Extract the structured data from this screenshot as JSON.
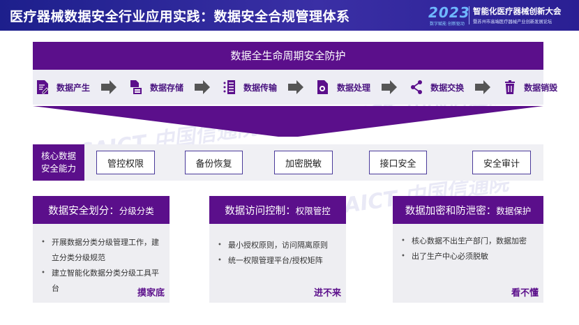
{
  "header": {
    "title": "医疗器械数据安全行业应用实践：数据安全合规管理体系",
    "conference": {
      "year": "2023",
      "slogan": "数字赋能 创新驱动",
      "name": "智能化医疗器械创新大会",
      "subtitle": "暨苏州市高端医疗器械产业创新发展论坛"
    }
  },
  "watermark": {
    "text": "CAICT 中国信通院"
  },
  "lifecycle": {
    "title": "数据全生命周期安全防护",
    "stages": [
      {
        "label": "数据产生",
        "icon": "document-edit-icon"
      },
      {
        "label": "数据存储",
        "icon": "document-storage-icon"
      },
      {
        "label": "数据传输",
        "icon": "transfer-list-icon"
      },
      {
        "label": "数据处理",
        "icon": "document-process-icon"
      },
      {
        "label": "数据交换",
        "icon": "share-icon"
      },
      {
        "label": "数据销毁",
        "icon": "trash-icon"
      }
    ],
    "arrow_icon": "right-arrow-icon"
  },
  "core": {
    "label_line1": "核心数据",
    "label_line2": "安全能力",
    "capabilities": [
      "管控权限",
      "备份恢复",
      "加密脱敏",
      "接口安全",
      "安全审计"
    ]
  },
  "cards": [
    {
      "title": "数据安全划分：",
      "subtitle": "分级分类",
      "bullets": [
        "开展数据分类分级管理工作，建立分类分级规范",
        "建立智能化数据分类分级工具平台"
      ],
      "footer": "摸家底"
    },
    {
      "title": "数据访问控制：",
      "subtitle": "权限管控",
      "bullets": [
        "最小授权原则，访问隔离原则",
        "统一权限管理平台/授权矩阵"
      ],
      "footer": "进不来"
    },
    {
      "title": "数据加密和防泄密：",
      "subtitle": "数据保护",
      "bullets": [
        "核心数据不出生产部门，数据加密",
        "出了生产中心必须脱敏"
      ],
      "footer": "看不懂"
    }
  ],
  "colors": {
    "primary_purple": "#5b0f8b",
    "header_blue": "#2a1f93",
    "panel_gray": "#ededf4"
  }
}
